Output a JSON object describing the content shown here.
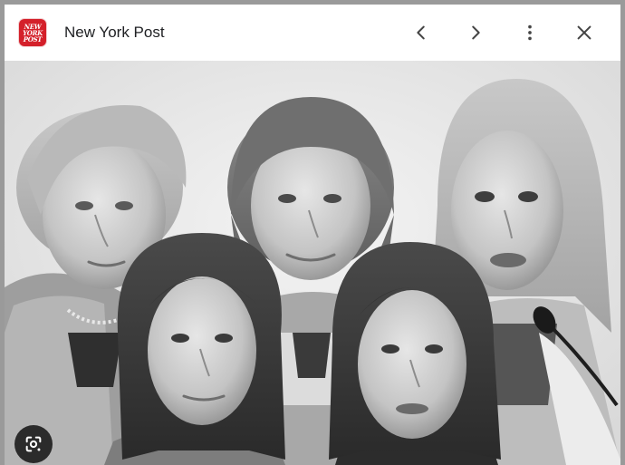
{
  "header": {
    "source_logo": {
      "lines": [
        "NEW",
        "YORK",
        "POST"
      ],
      "brand_color": "#d4202a"
    },
    "source_title": "New York Post",
    "icons": {
      "previous": "chevron-left-icon",
      "next": "chevron-right-icon",
      "more": "more-vert-icon",
      "close": "close-icon"
    }
  },
  "image": {
    "style": "grayscale photo collage of five women",
    "icon": "lens-search-icon"
  }
}
